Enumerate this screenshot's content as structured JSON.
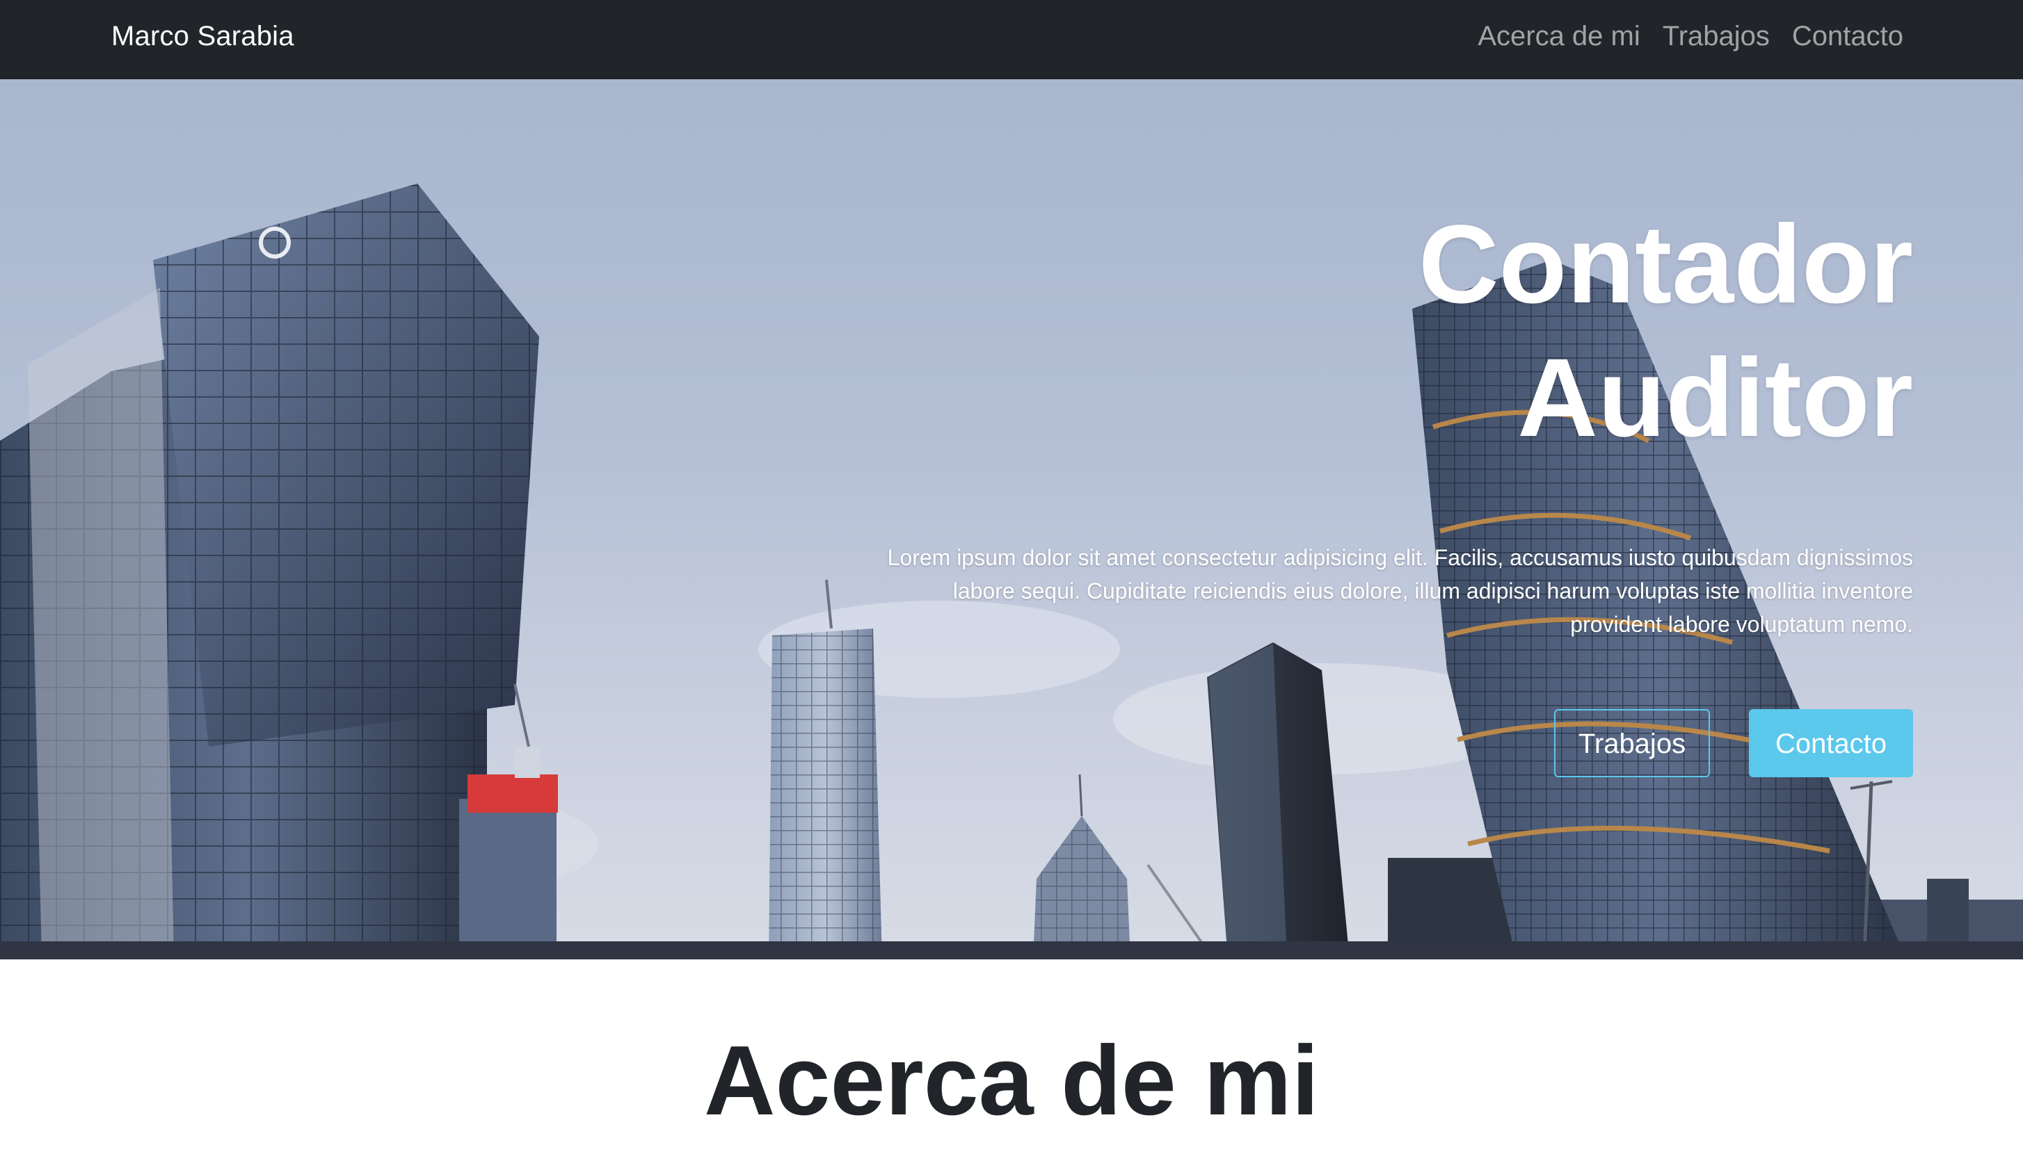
{
  "navbar": {
    "brand": "Marco Sarabia",
    "links": [
      {
        "label": "Acerca de mi"
      },
      {
        "label": "Trabajos"
      },
      {
        "label": "Contacto"
      }
    ],
    "background": "#212529"
  },
  "hero": {
    "title_line1": "Contador",
    "title_line2": "Auditor",
    "text": "Lorem ipsum dolor sit amet consectetur adipisicing elit. Facilis, accusamus iusto quibusdam dignissimos labore sequi. Cupiditate reiciendis eius dolore, illum adipisci harum voluptas iste mollitia inventore provident labore voluptatum nemo.",
    "buttons": {
      "primary_outline": "Trabajos",
      "primary_solid": "Contacto"
    },
    "accent": "#5bc8ec"
  },
  "about": {
    "title": "Acerca de mi"
  }
}
